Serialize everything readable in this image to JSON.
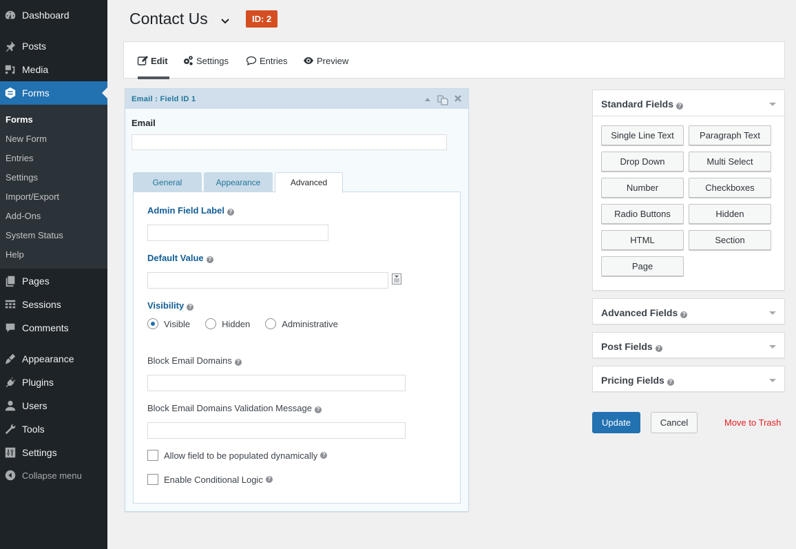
{
  "sidebar": {
    "items": [
      {
        "label": "Dashboard",
        "icon": "dashboard-icon"
      },
      {
        "label": "Posts",
        "icon": "pin-icon"
      },
      {
        "label": "Media",
        "icon": "media-icon"
      },
      {
        "label": "Forms",
        "icon": "forms-icon",
        "active": true
      },
      {
        "label": "Pages",
        "icon": "pages-icon"
      },
      {
        "label": "Sessions",
        "icon": "table-icon"
      },
      {
        "label": "Comments",
        "icon": "comment-icon"
      },
      {
        "label": "Appearance",
        "icon": "brush-icon"
      },
      {
        "label": "Plugins",
        "icon": "plug-icon"
      },
      {
        "label": "Users",
        "icon": "user-icon"
      },
      {
        "label": "Tools",
        "icon": "wrench-icon"
      },
      {
        "label": "Settings",
        "icon": "sliders-icon"
      },
      {
        "label": "Collapse menu",
        "icon": "collapse-icon"
      }
    ],
    "submenu": [
      "Forms",
      "New Form",
      "Entries",
      "Settings",
      "Import/Export",
      "Add-Ons",
      "System Status",
      "Help"
    ]
  },
  "header": {
    "title": "Contact Us",
    "id_badge": "ID: 2"
  },
  "top_tabs": [
    {
      "label": "Edit",
      "icon": "edit-icon",
      "active": true
    },
    {
      "label": "Settings",
      "icon": "gears-icon"
    },
    {
      "label": "Entries",
      "icon": "speech-bubble-icon"
    },
    {
      "label": "Preview",
      "icon": "eye-icon"
    }
  ],
  "field_editor": {
    "header_title": "Email : Field ID 1",
    "field_label": "Email",
    "preview_value": "",
    "tabs": [
      "General",
      "Appearance",
      "Advanced"
    ],
    "active_tab": "Advanced",
    "admin_field_label": {
      "label": "Admin Field Label",
      "value": ""
    },
    "default_value": {
      "label": "Default Value",
      "value": ""
    },
    "visibility": {
      "label": "Visibility",
      "options": [
        "Visible",
        "Hidden",
        "Administrative"
      ],
      "selected": "Visible"
    },
    "block_email_domains": {
      "label": "Block Email Domains",
      "value": ""
    },
    "block_email_msg": {
      "label": "Block Email Domains Validation Message",
      "value": ""
    },
    "allow_dynamic": {
      "label": "Allow field to be populated dynamically",
      "checked": false
    },
    "conditional_logic": {
      "label": "Enable Conditional Logic",
      "checked": false
    }
  },
  "right_panel": {
    "standard_fields": {
      "title": "Standard Fields",
      "buttons": [
        "Single Line Text",
        "Paragraph Text",
        "Drop Down",
        "Multi Select",
        "Number",
        "Checkboxes",
        "Radio Buttons",
        "Hidden",
        "HTML",
        "Section",
        "Page"
      ]
    },
    "collapsed_groups": [
      "Advanced Fields",
      "Post Fields",
      "Pricing Fields"
    ],
    "actions": {
      "update": "Update",
      "cancel": "Cancel",
      "trash": "Move to Trash"
    }
  },
  "colors": {
    "accent": "#2271b1",
    "badge": "#d54e21",
    "trash": "#e41e1e",
    "sidebar_bg": "#1d2327"
  }
}
